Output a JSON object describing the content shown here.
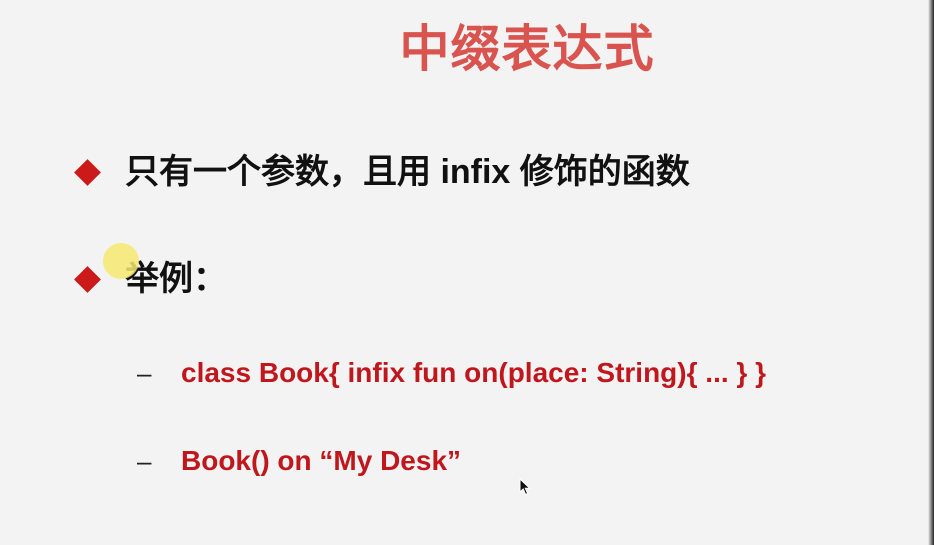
{
  "slide": {
    "title": "中缀表达式",
    "bullets": [
      {
        "text": "只有一个参数，且用 infix 修饰的函数"
      },
      {
        "text": "举例："
      }
    ],
    "sub_items": [
      {
        "dash": "–",
        "code": "class Book{ infix fun on(place: String){ ... } }"
      },
      {
        "dash": "–",
        "code": "Book() on “My Desk”"
      }
    ]
  },
  "colors": {
    "title": "#d9534f",
    "bullet_marker": "#cc1a1a",
    "code_text": "#c0171d",
    "body_text": "#111111",
    "background": "#f3f3f3",
    "pointer_highlight": "#f5e86e"
  },
  "icons": {
    "bullet_marker": "diamond-icon",
    "pointer": "mouse-cursor-icon"
  }
}
